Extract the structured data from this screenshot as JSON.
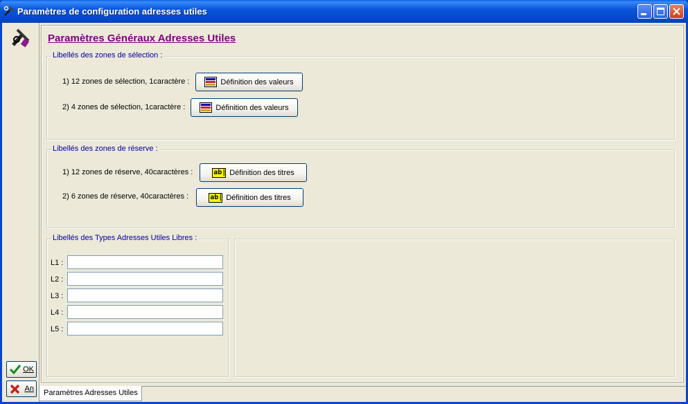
{
  "window": {
    "title": "Paramètres de configuration adresses utiles",
    "controls": [
      "minimize-icon",
      "maximize-icon",
      "close-icon"
    ]
  },
  "heading": "Paramètres Généraux Adresses Utiles",
  "selection_group": {
    "title": "Libellés des zones de sélection :",
    "rows": [
      {
        "label": "1) 12 zones de sélection, 1caractère :",
        "button": "Définition des valeurs",
        "icon": "list-icon"
      },
      {
        "label": "2) 4 zones de sélection, 1caractère :",
        "button": "Définition des valeurs",
        "icon": "list-icon"
      }
    ]
  },
  "reserve_group": {
    "title": "Libellés des zones de réserve :",
    "rows": [
      {
        "label": "1) 12 zones de réserve, 40caractères :",
        "button": "Définition des titres",
        "icon": "text-field-icon",
        "icon_text": "ab|"
      },
      {
        "label": "2) 6 zones de réserve, 40caractères :",
        "button": "Définition des titres",
        "icon": "text-field-icon",
        "icon_text": "ab|"
      }
    ]
  },
  "types_group": {
    "title": "Libellés des Types Adresses Utiles Libres :",
    "fields": [
      {
        "label": "L1 :",
        "value": ""
      },
      {
        "label": "L2 :",
        "value": ""
      },
      {
        "label": "L3 :",
        "value": ""
      },
      {
        "label": "L4 :",
        "value": ""
      },
      {
        "label": "L5 :",
        "value": ""
      }
    ]
  },
  "sidebar": {
    "ok_label": "OK",
    "cancel_label": "An"
  },
  "tabs": [
    {
      "label": "Paramètres Adresses Utiles"
    }
  ],
  "colors": {
    "titlebar": "#0a56dc",
    "heading": "#800080",
    "group_title": "#0000a0",
    "face": "#ece9d8"
  }
}
